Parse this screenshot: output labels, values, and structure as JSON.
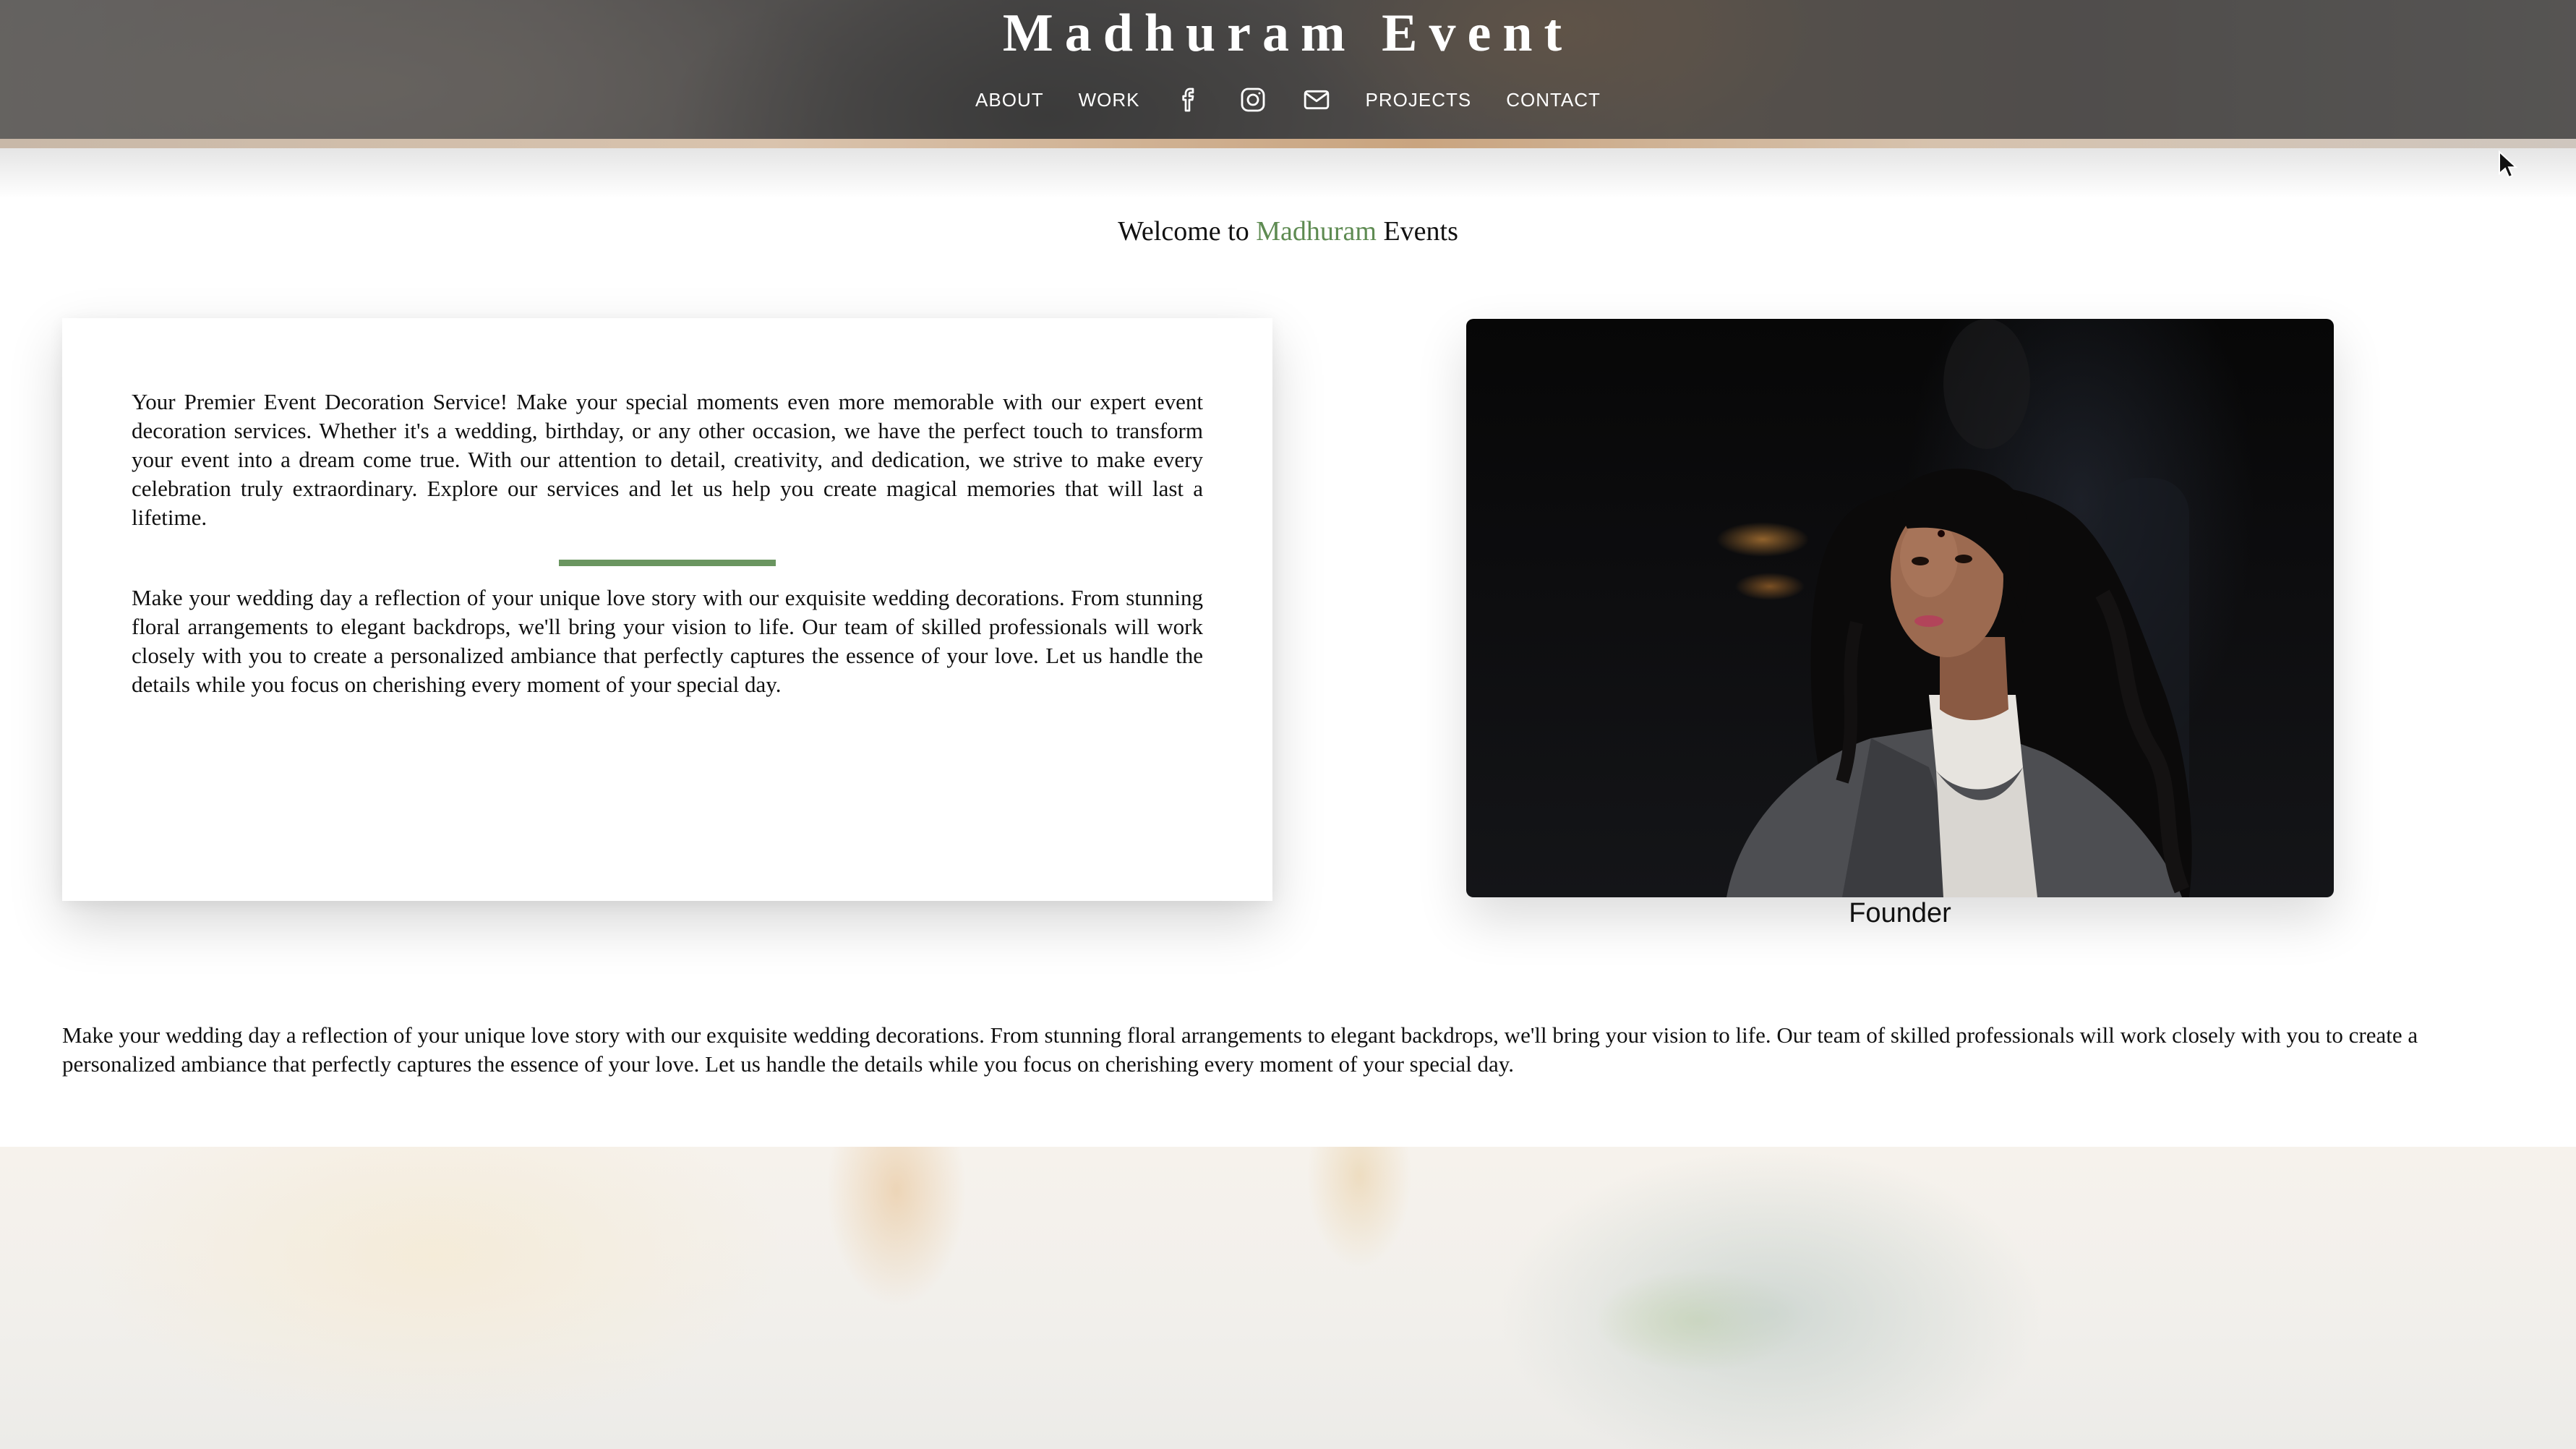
{
  "header": {
    "title": "Madhuram Event",
    "nav": {
      "about": "ABOUT",
      "work": "WORK",
      "projects": "PROJECTS",
      "contact": "CONTACT"
    },
    "icons": [
      "facebook-icon",
      "instagram-icon",
      "mail-icon"
    ]
  },
  "welcome": {
    "prefix": "Welcome to",
    "brand": "Madhuram",
    "suffix": "Events",
    "accent_color": "#5e8b52"
  },
  "about": {
    "paragraph_1": "Your Premier Event Decoration Service! Make your special moments even more memorable with our expert event decoration services. Whether it's a wedding, birthday, or any other occasion, we have the perfect touch to transform your event into a dream come true. With our attention to detail, creativity, and dedication, we strive to make every celebration truly extraordinary. Explore our services and let us help you create magical memories that will last a lifetime.",
    "paragraph_2": "Make your wedding day a reflection of your unique love story with our exquisite wedding decorations. From stunning floral arrangements to elegant backdrops, we'll bring your vision to life. Our team of skilled professionals will work closely with you to create a personalized ambiance that perfectly captures the essence of your love. Let us handle the details while you focus on cherishing every moment of your special day.",
    "divider_color": "#6a9560"
  },
  "founder": {
    "caption": "Founder"
  },
  "wedding_text": "Make your wedding day a reflection of your unique love story with our exquisite wedding decorations. From stunning floral arrangements to elegant backdrops, we'll bring your vision to life. Our team of skilled professionals will work closely with you to create a personalized ambiance that perfectly captures the essence of your love. Let us handle the details while you focus on cherishing every moment of your special day."
}
